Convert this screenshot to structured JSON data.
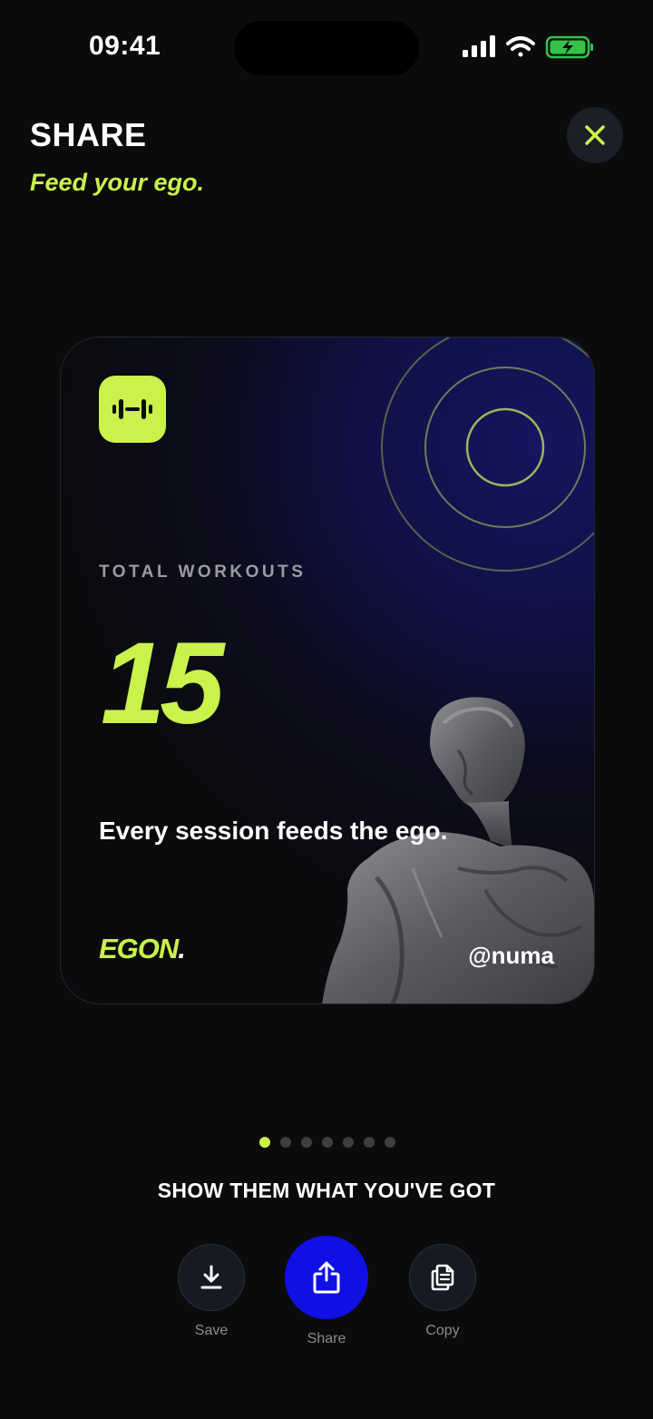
{
  "status_bar": {
    "time": "09:41"
  },
  "header": {
    "title": "SHARE",
    "subtitle": "Feed your ego."
  },
  "card": {
    "label": "TOTAL WORKOUTS",
    "value": "15",
    "tagline": "Every session feeds the ego.",
    "brand": "EGON",
    "brand_dot": ".",
    "handle": "@numa"
  },
  "pager": {
    "count": 7,
    "active_index": 0
  },
  "cta": {
    "heading": "SHOW THEM WHAT YOU'VE GOT"
  },
  "actions": [
    {
      "label": "Save",
      "icon": "download-icon"
    },
    {
      "label": "Share",
      "icon": "share-icon"
    },
    {
      "label": "Copy",
      "icon": "copy-icon"
    }
  ],
  "colors": {
    "accent": "#c9f24a",
    "primary": "#1010e6",
    "background": "#0b0b0b"
  }
}
